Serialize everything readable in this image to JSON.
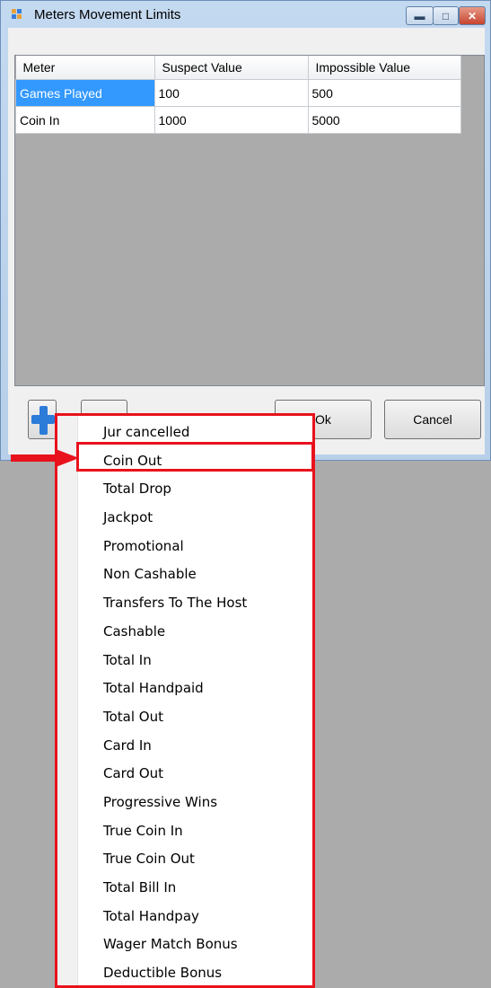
{
  "window": {
    "title": "Meters Movement Limits",
    "controls": [
      "minimize",
      "maximize",
      "close"
    ]
  },
  "grid": {
    "columns": [
      "Meter",
      "Suspect Value",
      "Impossible Value"
    ],
    "rows": [
      {
        "meter": "Games Played",
        "suspect": "100",
        "impossible": "500",
        "selected": true
      },
      {
        "meter": "Coin In",
        "suspect": "1000",
        "impossible": "5000",
        "selected": false
      }
    ]
  },
  "buttons": {
    "add_icon": "plus-icon",
    "ok_label": "Ok",
    "cancel_label": "Cancel"
  },
  "dropdown": {
    "items": [
      "Jur cancelled",
      "Coin Out",
      "Total Drop",
      "Jackpot",
      "Promotional",
      "Non Cashable",
      "Transfers To The Host",
      "Cashable",
      "Total In",
      "Total Handpaid",
      "Total Out",
      "Card In",
      "Card Out",
      "Progressive Wins",
      "True Coin In",
      "True Coin Out",
      "Total Bill In",
      "Total Handpay",
      "Wager Match Bonus",
      "Deductible Bonus"
    ],
    "highlighted_item": "Coin Out"
  },
  "annotation": {
    "color": "#e8121c"
  }
}
